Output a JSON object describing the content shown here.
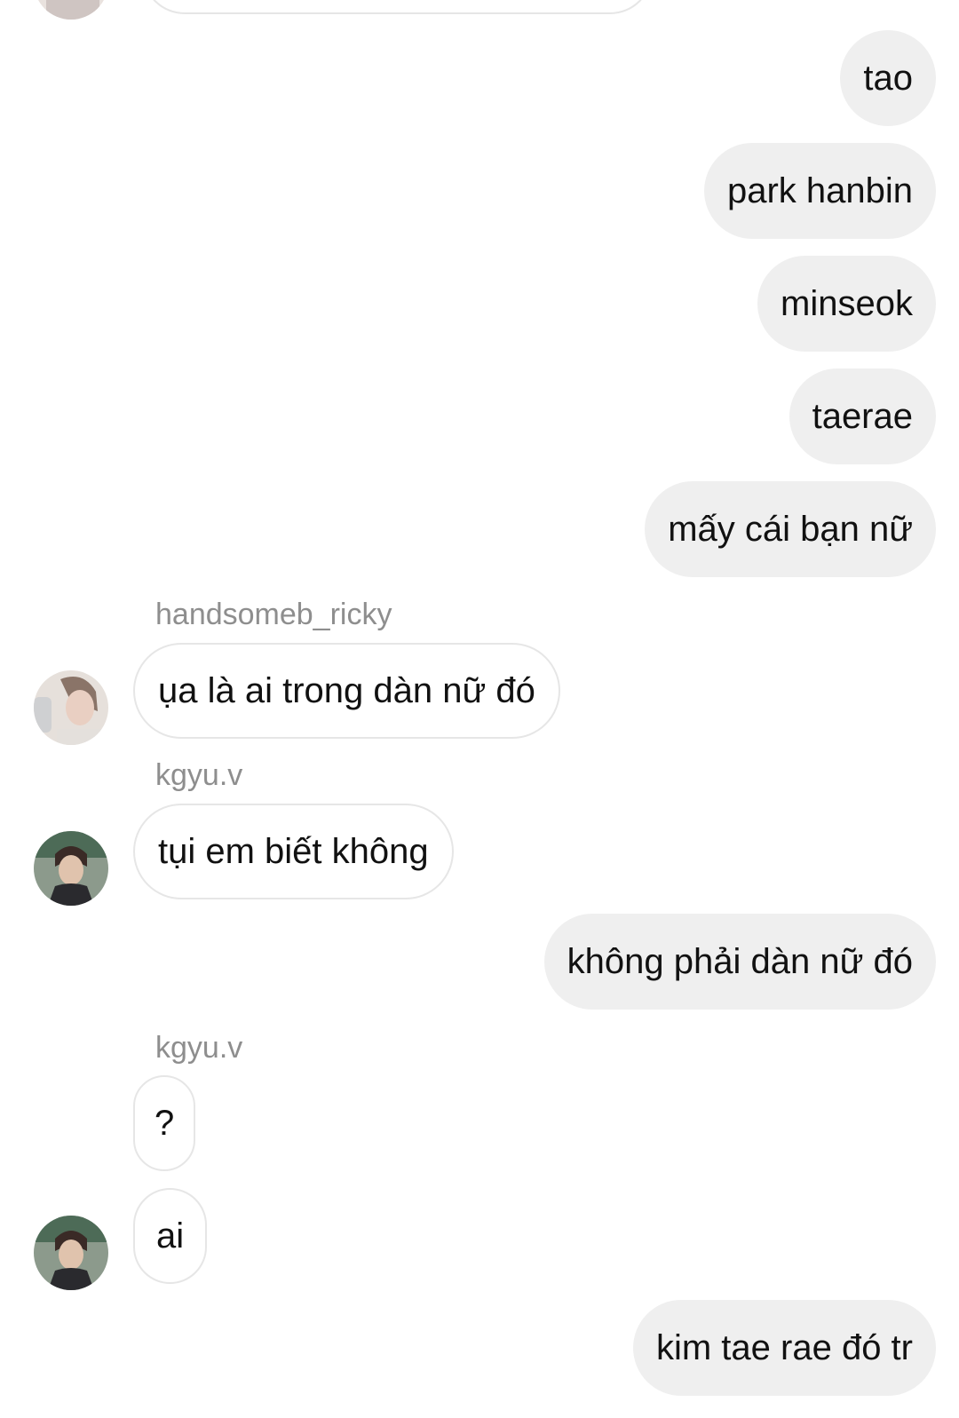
{
  "messages": {
    "m1": "tao",
    "m2": "park hanbin",
    "m3": "minseok",
    "m4": "taerae",
    "m5": "mấy cái bạn nữ",
    "m6_sender": "handsomeb_ricky",
    "m6": "ụa là ai trong dàn nữ đó",
    "m7_sender": "kgyu.v",
    "m7": "tụi em biết không",
    "m8": "không phải dàn nữ đó",
    "m9_sender": "kgyu.v",
    "m9": "?",
    "m10": "ai",
    "m11": "kim tae rae đó tr"
  },
  "colors": {
    "outgoing_bubble": "#efefef",
    "incoming_border": "#e6e6e6",
    "sender_label": "#8e8e8e"
  },
  "icons": {
    "avatar_ricky": "avatar-photo",
    "avatar_kgyu": "avatar-photo"
  }
}
